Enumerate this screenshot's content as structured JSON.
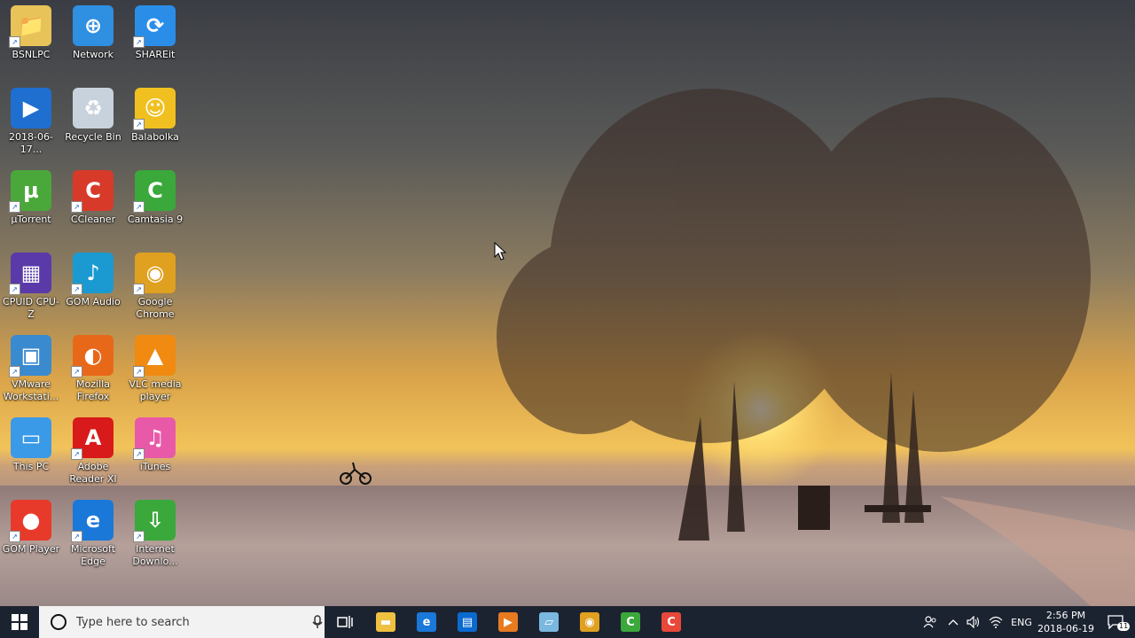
{
  "desktop_icons": [
    {
      "label": "BSNLPC",
      "icon": "user-folder-icon",
      "color": "#e8c35a"
    },
    {
      "label": "Network",
      "icon": "network-icon",
      "color": "#2f8fe0"
    },
    {
      "label": "SHAREit",
      "icon": "shareit-icon",
      "color": "#2a8de8"
    },
    {
      "label": "2018-06-17...",
      "icon": "video-file-icon",
      "color": "#1e6fd0"
    },
    {
      "label": "Recycle Bin",
      "icon": "recycle-bin-icon",
      "color": "#c8d2dc"
    },
    {
      "label": "Balabolka",
      "icon": "balabolka-icon",
      "color": "#f0c020"
    },
    {
      "label": "µTorrent",
      "icon": "utorrent-icon",
      "color": "#4aa83a"
    },
    {
      "label": "CCleaner",
      "icon": "ccleaner-icon",
      "color": "#d83a2a"
    },
    {
      "label": "Camtasia 9",
      "icon": "camtasia-icon",
      "color": "#3aa83a"
    },
    {
      "label": "CPUID CPU-Z",
      "icon": "cpuz-icon",
      "color": "#5a3aa8"
    },
    {
      "label": "GOM Audio",
      "icon": "gom-audio-icon",
      "color": "#1a9ad0"
    },
    {
      "label": "Google Chrome",
      "icon": "chrome-icon",
      "color": "#e0a020"
    },
    {
      "label": "VMware Workstati...",
      "icon": "vmware-icon",
      "color": "#3a8ad0"
    },
    {
      "label": "Mozilla Firefox",
      "icon": "firefox-icon",
      "color": "#e8681a"
    },
    {
      "label": "VLC media player",
      "icon": "vlc-icon",
      "color": "#f08a10"
    },
    {
      "label": "This PC",
      "icon": "this-pc-icon",
      "color": "#3a9ae8"
    },
    {
      "label": "Adobe Reader XI",
      "icon": "adobe-reader-icon",
      "color": "#d81a1a"
    },
    {
      "label": "iTunes",
      "icon": "itunes-icon",
      "color": "#e85aa8"
    },
    {
      "label": "GOM Player",
      "icon": "gom-player-icon",
      "color": "#e83a2a"
    },
    {
      "label": "Microsoft Edge",
      "icon": "edge-icon",
      "color": "#1a78d8"
    },
    {
      "label": "Internet Downlo...",
      "icon": "internet-download-manager-icon",
      "color": "#3aa83a"
    }
  ],
  "taskbar": {
    "search_placeholder": "Type here to search",
    "pinned_apps": [
      {
        "name": "file-explorer",
        "icon": "folder-icon",
        "color": "#f0c040"
      },
      {
        "name": "edge",
        "icon": "edge-icon",
        "color": "#1a78d8"
      },
      {
        "name": "store",
        "icon": "store-icon",
        "color": "#0a6ad0"
      },
      {
        "name": "media",
        "icon": "media-player-icon",
        "color": "#e87a20"
      },
      {
        "name": "notes",
        "icon": "notepad-icon",
        "color": "#7ab8e0"
      },
      {
        "name": "chrome",
        "icon": "chrome-icon",
        "color": "#e0a020"
      },
      {
        "name": "camtasia",
        "icon": "camtasia-icon",
        "color": "#3aa83a"
      },
      {
        "name": "camtasia-recorder",
        "icon": "camtasia-recorder-icon",
        "color": "#e8483a"
      }
    ],
    "language": "ENG",
    "time": "2:56 PM",
    "date": "2018-06-19",
    "notification_count": "11"
  }
}
